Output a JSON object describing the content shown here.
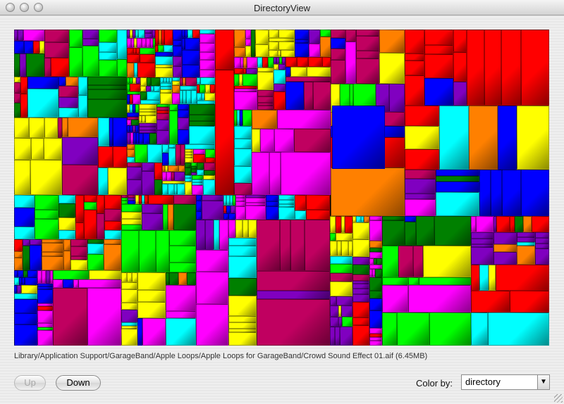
{
  "window": {
    "title": "DirectoryView"
  },
  "status": {
    "selected_path": "Library/Application Support/GarageBand/Apple Loops/Apple Loops for GarageBand/Crowd Sound Effect 01.aif (6.45MB)"
  },
  "controls": {
    "up_label": "Up",
    "down_label": "Down",
    "color_by_label": "Color by:",
    "color_by_value": "directory"
  },
  "palette": [
    "#ff0000",
    "#ffff00",
    "#00ff00",
    "#00ffff",
    "#0000ff",
    "#ff00ff",
    "#ff8000",
    "#8000c0",
    "#008000",
    "#c00060",
    "#ffffff"
  ],
  "icons": {
    "dropdown": "chevron-down-icon",
    "resize": "resize-grip-icon"
  }
}
